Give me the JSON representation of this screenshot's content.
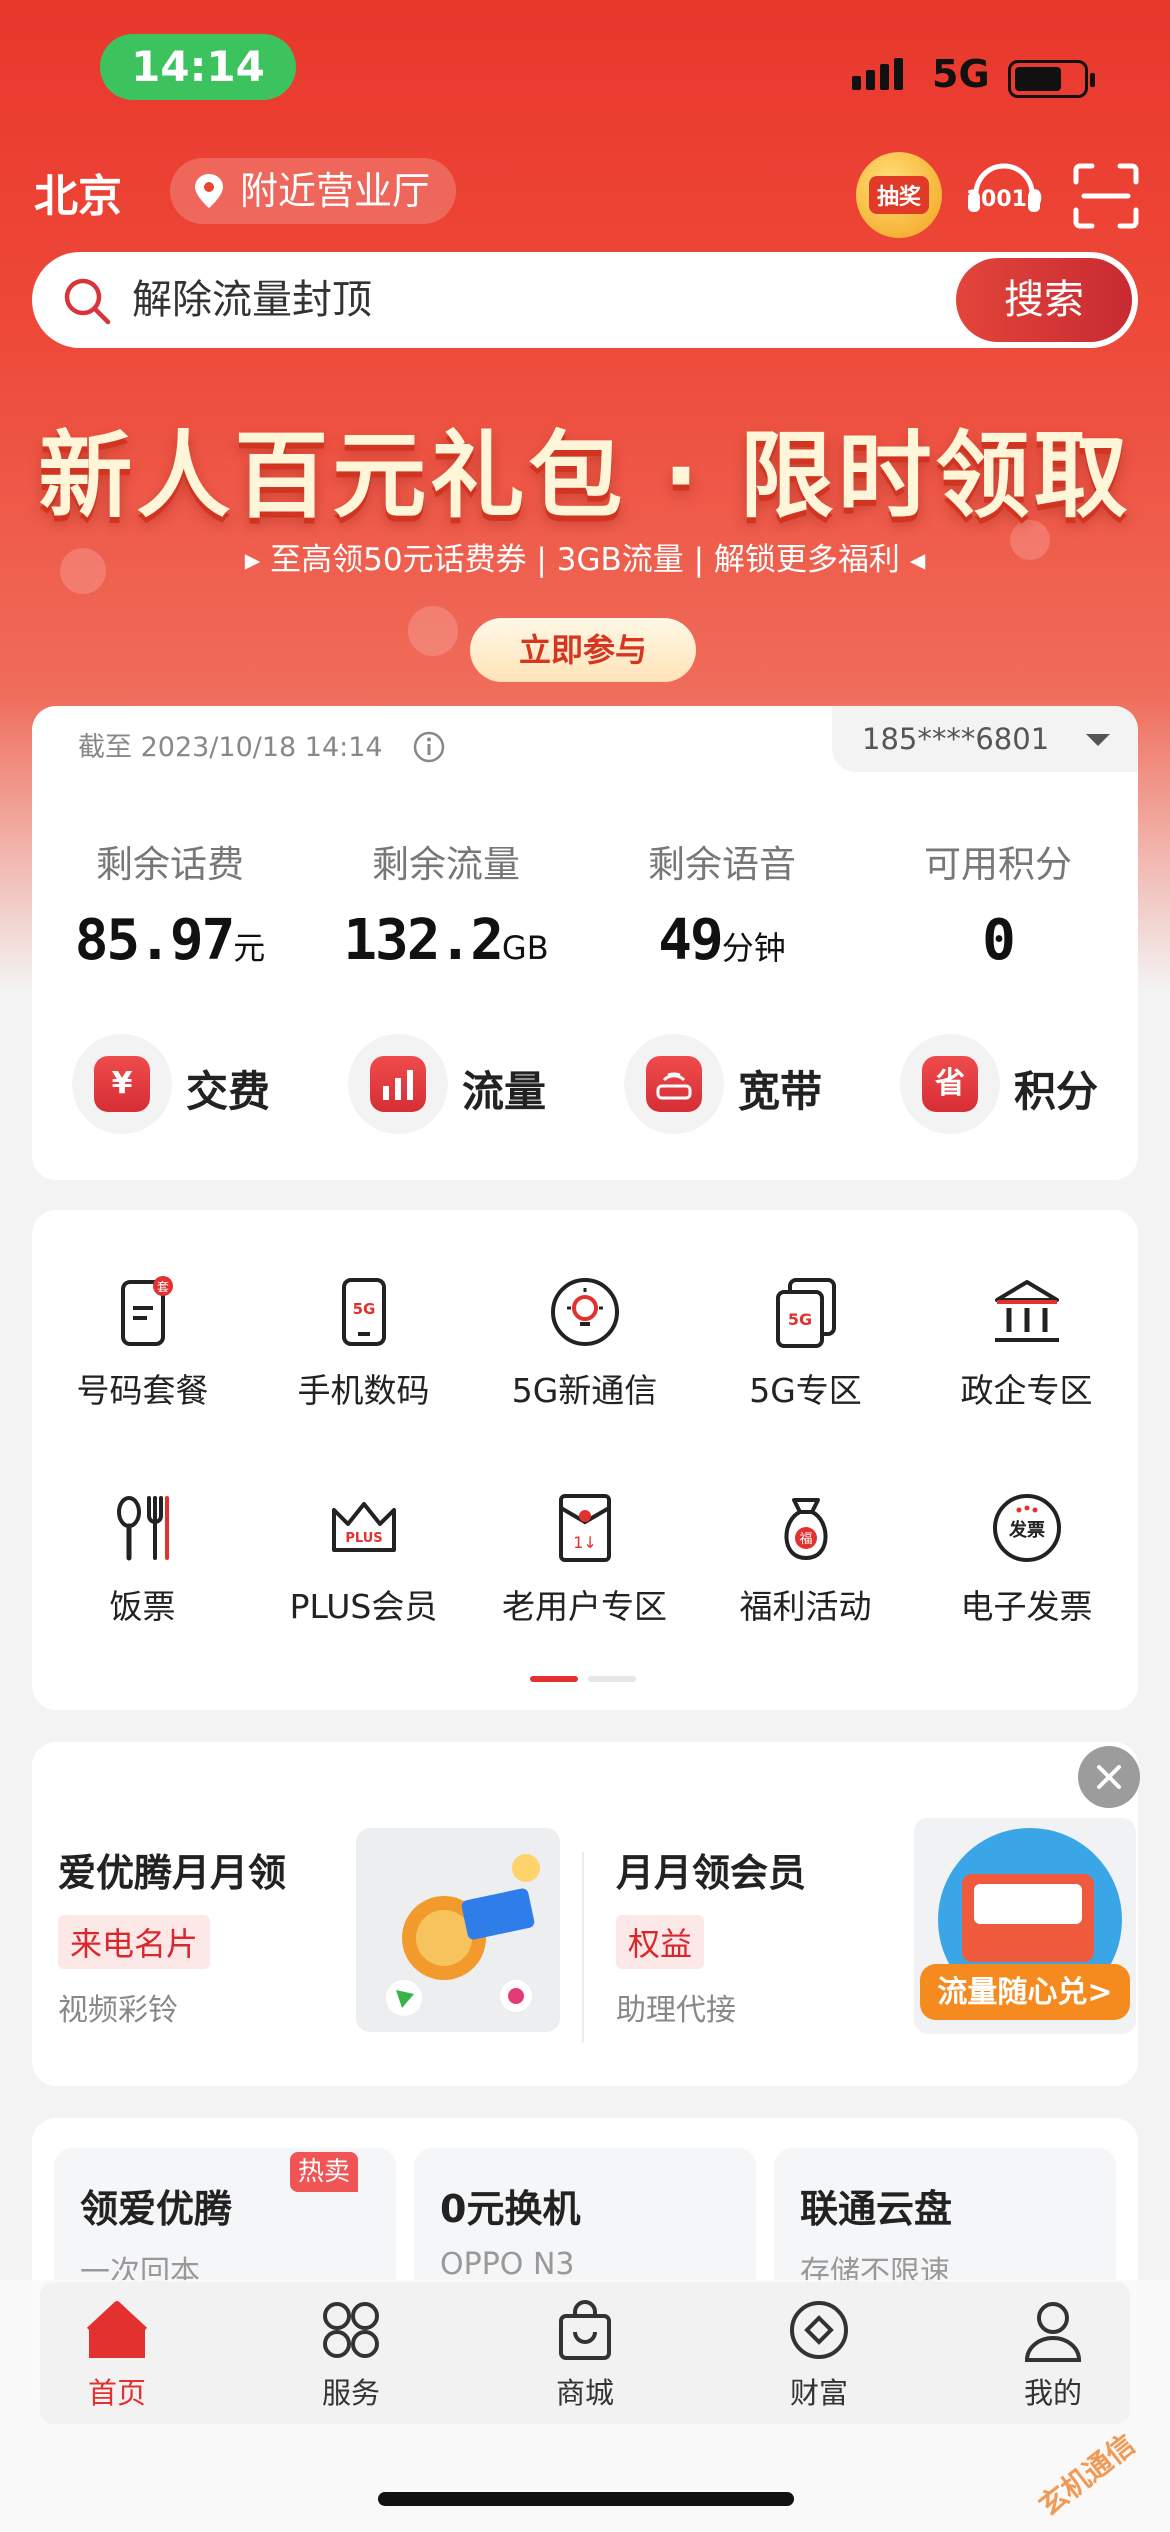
{
  "status_bar": {
    "time": "14:14",
    "network": "5G"
  },
  "header": {
    "city": "北京",
    "nearby_label": "附近营业厅",
    "lottery_label": "抽奖",
    "service_number": "10010"
  },
  "search": {
    "placeholder": "解除流量封顶",
    "button": "搜索"
  },
  "banner": {
    "title": "新人百元礼包 · 限时领取",
    "subtitle": "▸ 至高领50元话费券 | 3GB流量 | 解锁更多福利 ◂",
    "cta": "立即参与"
  },
  "account": {
    "as_of": "截至 2023/10/18 14:14",
    "phone": "185****6801",
    "stats": [
      {
        "label": "剩余话费",
        "value": "85.97",
        "unit": "元"
      },
      {
        "label": "剩余流量",
        "value": "132.2",
        "unit": "GB"
      },
      {
        "label": "剩余语音",
        "value": "49",
        "unit": "分钟"
      },
      {
        "label": "可用积分",
        "value": "0",
        "unit": ""
      }
    ],
    "quick_actions": [
      {
        "label": "交费",
        "glyph": "¥"
      },
      {
        "label": "流量",
        "glyph": "▮"
      },
      {
        "label": "宽带",
        "glyph": "◎"
      },
      {
        "label": "积分",
        "glyph": "省"
      }
    ]
  },
  "services": {
    "items": [
      {
        "label": "号码套餐",
        "icon": "phone-plan-icon"
      },
      {
        "label": "手机数码",
        "icon": "phone-5g-icon"
      },
      {
        "label": "5G新通信",
        "icon": "bulb-icon"
      },
      {
        "label": "5G专区",
        "icon": "5g-zone-icon"
      },
      {
        "label": "政企专区",
        "icon": "bank-icon"
      },
      {
        "label": "饭票",
        "icon": "cutlery-icon"
      },
      {
        "label": "PLUS会员",
        "icon": "crown-icon"
      },
      {
        "label": "老用户专区",
        "icon": "envelope-icon"
      },
      {
        "label": "福利活动",
        "icon": "lucky-bag-icon"
      },
      {
        "label": "电子发票",
        "icon": "invoice-icon"
      }
    ],
    "page": 1,
    "pages": 2
  },
  "promos": [
    {
      "title": "爱优腾月月领",
      "tag": "来电名片",
      "desc": "视频彩铃"
    },
    {
      "title": "月月领会员",
      "tag": "权益",
      "desc": "助理代接"
    }
  ],
  "promo_image_text": "流量随心兑>",
  "tiles": [
    {
      "title": "领爱优腾",
      "sub": "一次回本",
      "badge": "热卖"
    },
    {
      "title": "0元换机",
      "sub": "OPPO N3"
    },
    {
      "title": "联通云盘",
      "sub": "存储不限速"
    }
  ],
  "tabbar": [
    {
      "label": "首页",
      "active": true
    },
    {
      "label": "服务"
    },
    {
      "label": "商城"
    },
    {
      "label": "财富"
    },
    {
      "label": "我的"
    }
  ],
  "watermark": "玄机通信",
  "colors": {
    "brand_red": "#e2312e",
    "status_green": "#3cc35e"
  }
}
